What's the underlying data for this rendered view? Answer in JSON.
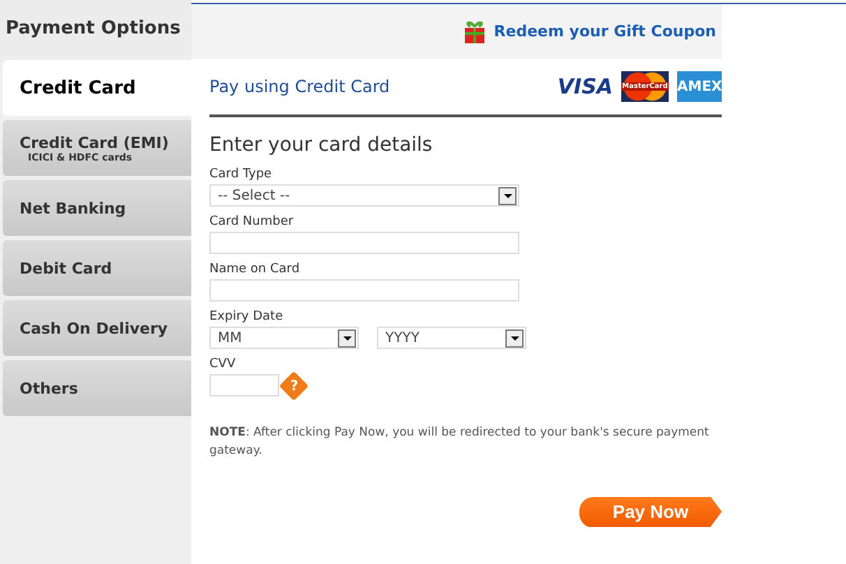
{
  "sidebar": {
    "title": "Payment Options",
    "items": [
      {
        "label": "Credit Card",
        "selected": true
      },
      {
        "label": "Credit Card (EMI)",
        "sublabel": "ICICI & HDFC cards",
        "selected": false
      },
      {
        "label": "Net Banking",
        "selected": false
      },
      {
        "label": "Debit Card",
        "selected": false
      },
      {
        "label": "Cash On Delivery",
        "selected": false
      },
      {
        "label": "Others",
        "selected": false
      }
    ]
  },
  "header": {
    "gift_link": "Redeem your Gift Coupon"
  },
  "panel": {
    "title": "Pay using Credit Card",
    "card_logos": [
      {
        "kind": "visa",
        "label": "VISA"
      },
      {
        "kind": "mastercard",
        "label": "MasterCard"
      },
      {
        "kind": "amex",
        "label": "AMEX"
      }
    ],
    "form_title": "Enter your card details",
    "fields": [
      {
        "kind": "select",
        "label": "Card Type",
        "value": "-- Select --"
      },
      {
        "kind": "text",
        "label": "Card Number"
      },
      {
        "kind": "text",
        "label": "Name on Card"
      },
      {
        "kind": "pair",
        "label": "Expiry Date",
        "month": "MM",
        "year": "YYYY"
      },
      {
        "kind": "cvv",
        "label": "CVV",
        "help": "?"
      }
    ],
    "note": "**NOTE**: After clicking Pay Now, you will be redirected to your bank's secure payment gateway.",
    "pay_button": "Pay Now"
  }
}
